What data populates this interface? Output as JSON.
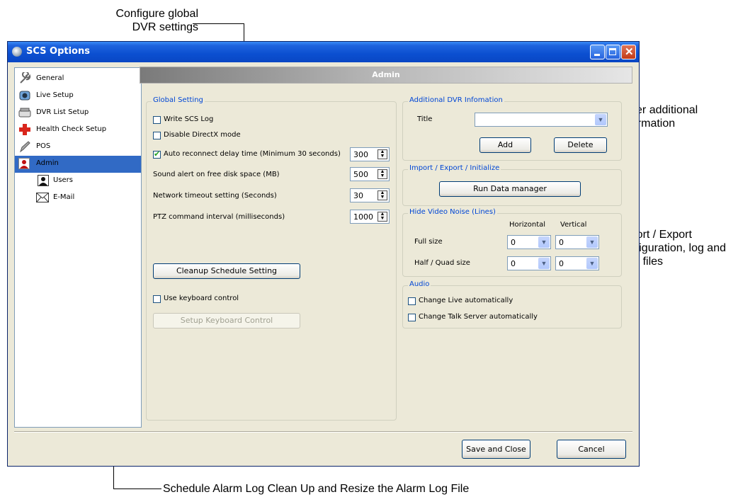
{
  "callouts": {
    "global": "Configure global\nDVR settings",
    "additional": "Enter additional\ninformation",
    "import": "Import / Export\nconfiguration, log and\nmap files",
    "schedule": "Schedule Alarm Log Clean Up and Resize the Alarm Log File"
  },
  "window": {
    "title": "SCS Options"
  },
  "sidebar": {
    "items": [
      {
        "label": "General",
        "icon": "wrench-icon"
      },
      {
        "label": "Live Setup",
        "icon": "camera-icon"
      },
      {
        "label": "DVR List Setup",
        "icon": "dvr-icon"
      },
      {
        "label": "Health Check Setup",
        "icon": "health-cross-icon"
      },
      {
        "label": "POS",
        "icon": "pen-icon"
      },
      {
        "label": "Admin",
        "icon": "admin-user-icon",
        "selected": true
      },
      {
        "label": "Users",
        "icon": "user-icon"
      },
      {
        "label": "E-Mail",
        "icon": "envelope-icon"
      }
    ]
  },
  "panel": {
    "header": "Admin"
  },
  "global_setting": {
    "title": "Global Setting",
    "write_log": "Write SCS Log",
    "disable_directx": "Disable DirectX mode",
    "auto_reconnect": "Auto reconnect delay time (Minimum 30 seconds)",
    "auto_reconnect_value": "300",
    "sound_alert": "Sound alert on free disk space (MB)",
    "sound_alert_value": "500",
    "network_timeout": "Network timeout setting (Seconds)",
    "network_timeout_value": "30",
    "ptz_interval": "PTZ command interval (milliseconds)",
    "ptz_interval_value": "1000",
    "cleanup_button": "Cleanup Schedule Setting",
    "use_keyboard": "Use keyboard control",
    "setup_keyboard_button": "Setup Keyboard Control"
  },
  "additional_dvr": {
    "title": "Additional DVR Infomation",
    "title_label": "Title",
    "title_value": "",
    "add_button": "Add",
    "delete_button": "Delete"
  },
  "import_export": {
    "title": "Import / Export / Initialize",
    "run_button": "Run Data manager"
  },
  "hide_noise": {
    "title": "Hide Video Noise (Lines)",
    "horizontal": "Horizontal",
    "vertical": "Vertical",
    "full_size": "Full size",
    "full_h": "0",
    "full_v": "0",
    "half_size": "Half / Quad size",
    "half_h": "0",
    "half_v": "0"
  },
  "audio": {
    "title": "Audio",
    "change_live": "Change Live automatically",
    "change_talk": "Change Talk Server automatically"
  },
  "footer": {
    "save_button": "Save and Close",
    "cancel_button": "Cancel"
  },
  "colors": {
    "titlebar": "#0a47c4",
    "selection": "#316ac5",
    "group_title": "#0046d5"
  }
}
